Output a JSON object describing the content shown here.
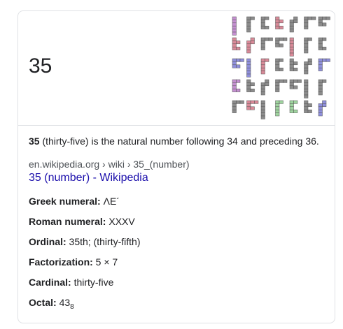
{
  "title": "35",
  "description": {
    "bold": "35",
    "text": " (thirty-five) is the natural number following 34 and preceding 36."
  },
  "source": {
    "url": "en.wikipedia.org › wiki › 35_(number)",
    "link_text": "35 (number) - Wikipedia"
  },
  "facts": [
    {
      "key": "Greek numeral:",
      "value": " ΛΕ´"
    },
    {
      "key": "Roman numeral:",
      "value": " XXXV"
    },
    {
      "key": "Ordinal:",
      "value": " 35th; (thirty-fifth)"
    },
    {
      "key": "Factorization:",
      "value": " 5 × 7"
    },
    {
      "key": "Cardinal:",
      "value": " thirty-five"
    },
    {
      "key": "Octal:",
      "value": " 43",
      "sub": "8"
    }
  ],
  "colors": {
    "link": "#1a0dab",
    "border": "#dfe1e5",
    "hexomino_gray": "#8c8c8c",
    "hexomino_pink": "#d98a98",
    "hexomino_blue": "#8f8fdb",
    "hexomino_purple": "#c48fd0",
    "hexomino_green": "#9fd49f"
  },
  "image": {
    "icon": "hexominoes-image"
  }
}
